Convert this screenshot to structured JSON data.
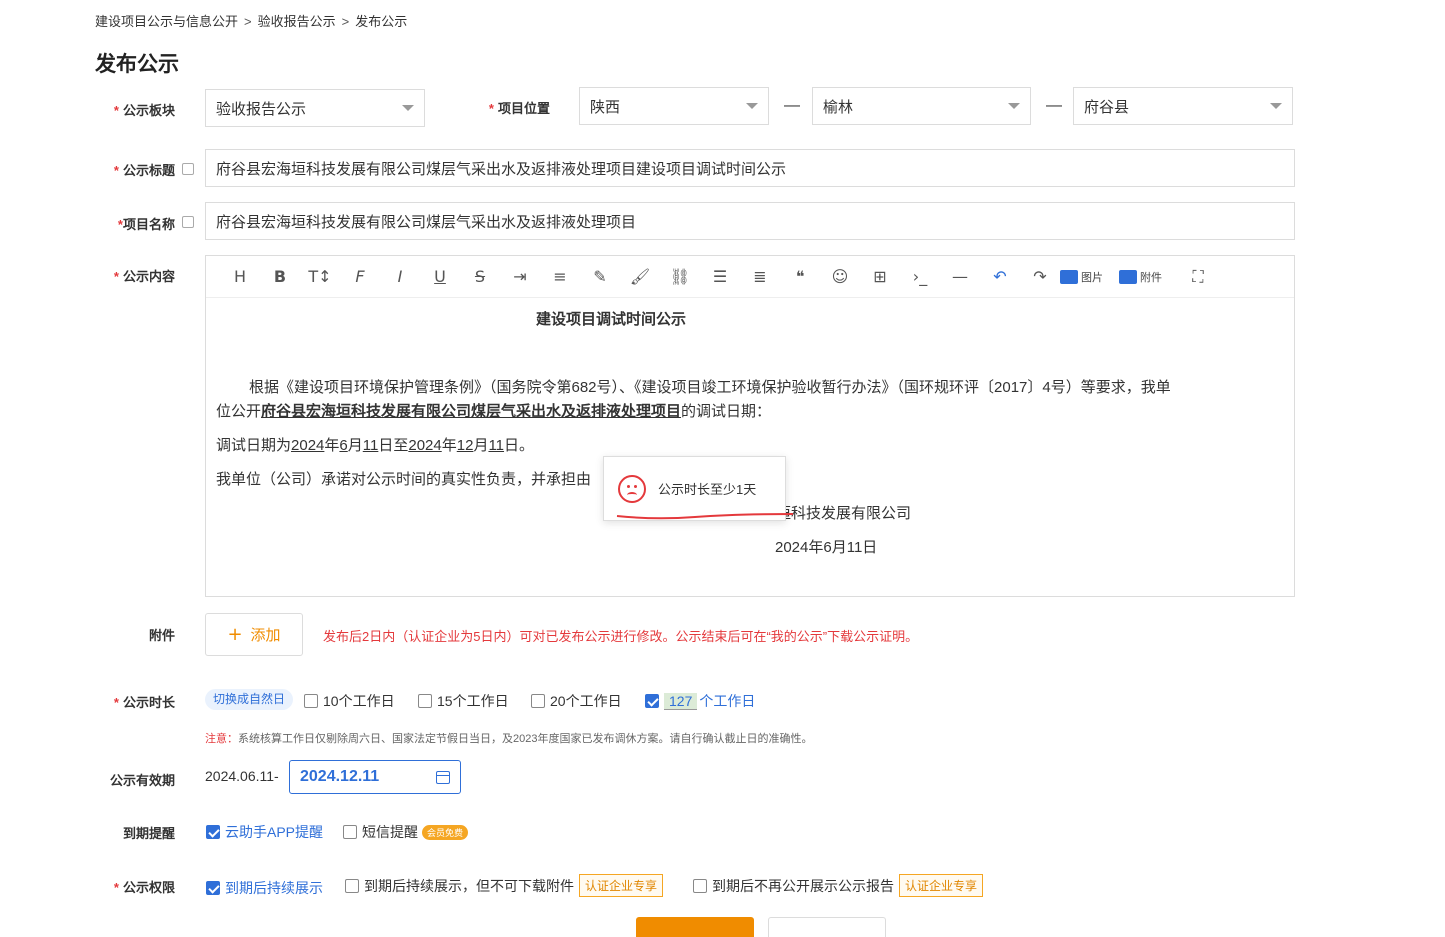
{
  "breadcrumb": [
    "建设项目公示与信息公开",
    "验收报告公示",
    "发布公示"
  ],
  "breadcrumb_sep": ">",
  "page_title": "发布公示",
  "required_mark": "*",
  "form": {
    "board": {
      "label": "公示板块",
      "value": "验收报告公示"
    },
    "location": {
      "label": "项目位置",
      "province": "陕西",
      "city": "榆林",
      "county": "府谷县",
      "sep": "—"
    },
    "title": {
      "label": "公示标题",
      "value": "府谷县宏海垣科技发展有限公司煤层气采出水及返排液处理项目建设项目调试时间公示"
    },
    "project_name": {
      "label": "项目名称",
      "value": "府谷县宏海垣科技发展有限公司煤层气采出水及返排液处理项目"
    },
    "content": {
      "label": "公示内容",
      "toolbar": {
        "image": "图片",
        "attachment": "附件"
      },
      "doc_title": "建设项目调试时间公示",
      "p1a": "根据《建设项目环境保护管理条例》（国务院令第682号）、《建设项目竣工环境保护验收暂行办法》（国环规环评〔2017〕4号）等要求，我单",
      "p1b_prefix": "位公开",
      "p1b_project": "府谷县宏海垣科技发展有限公司煤层气采出水及返排液处理项目",
      "p1b_suffix": "的调试日期：",
      "p2": {
        "pre": "调试日期为",
        "y1": "2024",
        "t1": "年",
        "m1": "6",
        "t2": "月",
        "d1": "11",
        "t3": "日至",
        "y2": "2024",
        "t4": "年",
        "m2": "12",
        "t5": "月",
        "d2": "11",
        "t6": "日。"
      },
      "p3": "我单位（公司）承诺对公示时间的真实性负责，并承担由",
      "sign_company": "垣科技发展有限公司",
      "sign_date": "2024年6月11日"
    },
    "toast": "公示时长至少1天",
    "attachment": {
      "label": "附件",
      "add": "添加",
      "hint": "发布后2日内（认证企业为5日内）可对已发布公示进行修改。公示结束后可在“我的公示”下载公示证明。"
    },
    "duration": {
      "label": "公示时长",
      "switch": "切换成自然日",
      "options": [
        "10个工作日",
        "15个工作日",
        "20个工作日"
      ],
      "custom_value": "127",
      "custom_suffix": "个工作日",
      "note_prefix": "注意：",
      "note": "系统核算工作日仅剔除周六日、国家法定节假日当日，及2023年度国家已发布调休方案。请自行确认截止日的准确性。"
    },
    "validity": {
      "label": "公示有效期",
      "start": "2024.06.11-",
      "end": "2024.12.11"
    },
    "reminder": {
      "label": "到期提醒",
      "app": "云助手APP提醒",
      "sms": "短信提醒",
      "sms_badge": "会员免费"
    },
    "permission": {
      "label": "公示权限",
      "opt1": "到期后持续展示",
      "opt2": "到期后持续展示，但不可下载附件",
      "opt3": "到期后不再公开展示公示报告",
      "cert_badge": "认证企业专享"
    }
  },
  "colors": {
    "accent": "#2f6fd8",
    "required": "#e4393c",
    "orange": "#f08c00"
  }
}
